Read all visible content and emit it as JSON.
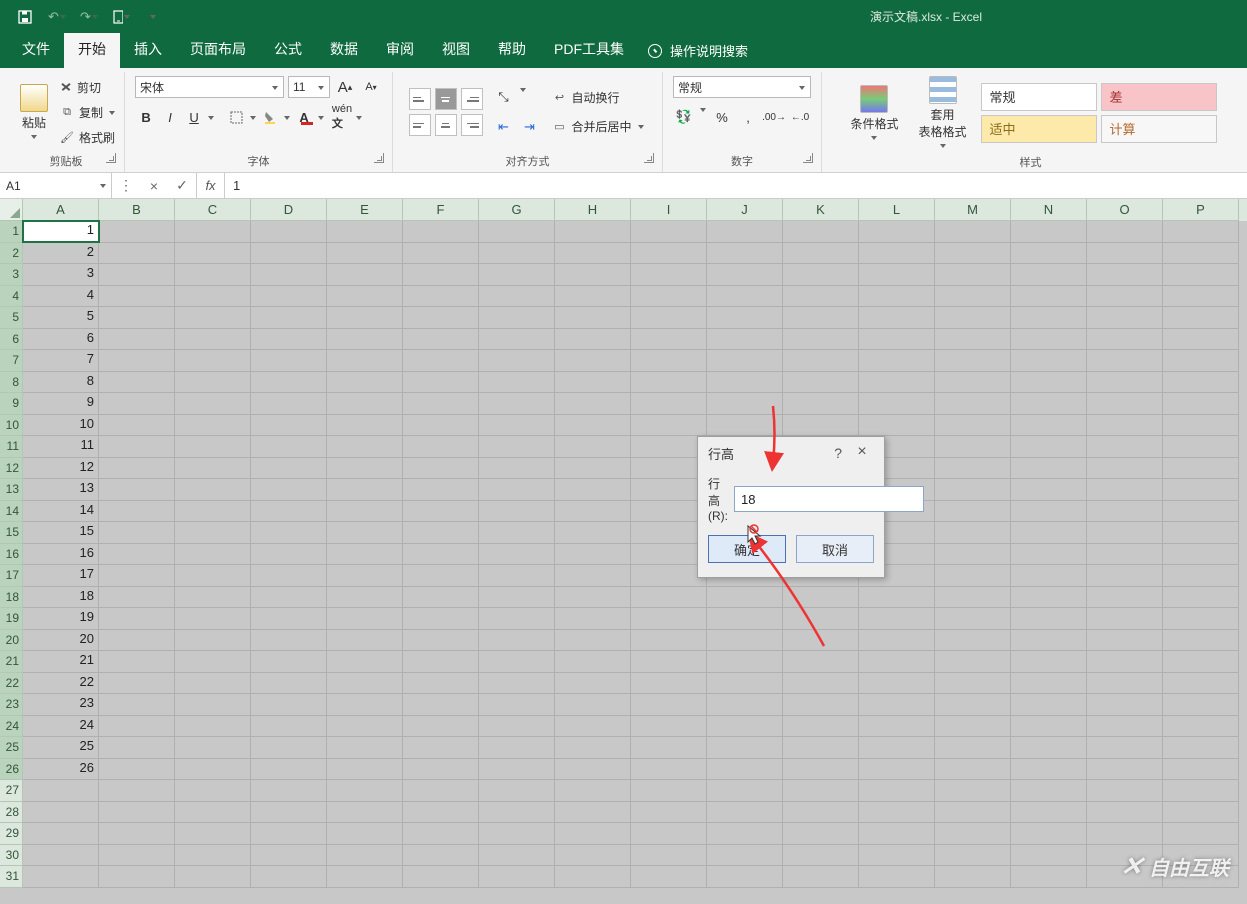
{
  "title": "演示文稿.xlsx  -  Excel",
  "tabs": [
    "文件",
    "开始",
    "插入",
    "页面布局",
    "公式",
    "数据",
    "审阅",
    "视图",
    "帮助",
    "PDF工具集"
  ],
  "active_tab_index": 1,
  "tell_me": "操作说明搜索",
  "clipboard": {
    "paste": "粘贴",
    "cut": "剪切",
    "copy": "复制",
    "painter": "格式刷",
    "label": "剪贴板"
  },
  "font": {
    "name": "宋体",
    "size": "11",
    "grow": "A",
    "shrink": "A",
    "label": "字体",
    "bold": "B",
    "italic": "I",
    "underline": "U"
  },
  "align": {
    "wrap": "自动换行",
    "merge": "合并后居中",
    "label": "对齐方式"
  },
  "number": {
    "format": "常规",
    "percent": "%",
    "label": "数字"
  },
  "styles": {
    "cond": "条件格式",
    "table": "套用\n表格格式",
    "label": "样式",
    "cells": [
      {
        "t": "常规",
        "bg": "#ffffff",
        "c": "#333"
      },
      {
        "t": "差",
        "bg": "#f9c4c8",
        "c": "#a03030"
      },
      {
        "t": "适中",
        "bg": "#fde9a9",
        "c": "#8a6d1a"
      },
      {
        "t": "计算",
        "bg": "#f7f7f7",
        "c": "#b66a2e"
      }
    ]
  },
  "name_box": "A1",
  "formula": "1",
  "columns": [
    "A",
    "B",
    "C",
    "D",
    "E",
    "F",
    "G",
    "H",
    "I",
    "J",
    "K",
    "L",
    "M",
    "N",
    "O",
    "P"
  ],
  "row_count": 31,
  "cell_values": {
    "1": "1",
    "2": "2",
    "3": "3",
    "4": "4",
    "5": "5",
    "6": "6",
    "7": "7",
    "8": "8",
    "9": "9",
    "10": "10",
    "11": "11",
    "12": "12",
    "13": "13",
    "14": "14",
    "15": "15",
    "16": "16",
    "17": "17",
    "18": "18",
    "19": "19",
    "20": "20",
    "21": "21",
    "22": "22",
    "23": "23",
    "24": "24",
    "25": "25",
    "26": "26"
  },
  "dialog": {
    "title": "行高",
    "label": "行高(R):",
    "value": "18",
    "ok": "确定",
    "cancel": "取消",
    "help": "?",
    "close": "×"
  },
  "watermark": "自由互联"
}
